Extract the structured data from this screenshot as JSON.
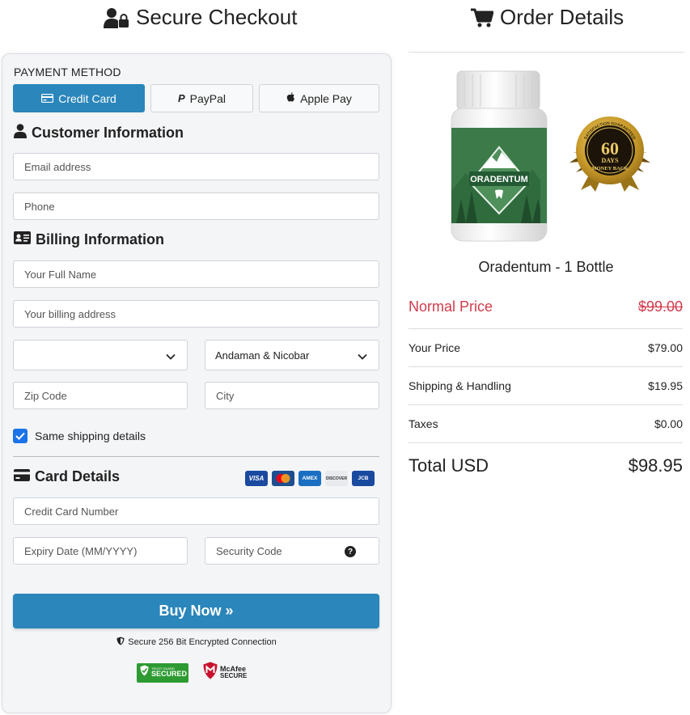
{
  "checkout": {
    "title": "Secure Checkout",
    "payment_method_label": "PAYMENT METHOD",
    "tabs": [
      {
        "label": "Credit Card",
        "active": true
      },
      {
        "label": "PayPal",
        "active": false
      },
      {
        "label": "Apple Pay",
        "active": false
      }
    ],
    "customer_title": "Customer Information",
    "email_placeholder": "Email address",
    "phone_placeholder": "Phone",
    "billing_title": "Billing Information",
    "fullname_placeholder": "Your Full Name",
    "address_placeholder": "Your billing address",
    "country_value": "",
    "state_value": "Andaman & Nicobar",
    "zip_placeholder": "Zip Code",
    "city_placeholder": "City",
    "same_shipping_label": "Same shipping details",
    "same_shipping_checked": true,
    "card_title": "Card Details",
    "card_brands": [
      "VISA",
      "mastercard",
      "AMEX",
      "DISCOVER",
      "JCB"
    ],
    "card_number_placeholder": "Credit Card Number",
    "expiry_placeholder": "Expiry Date (MM/YYYY)",
    "cvv_placeholder": "Security Code",
    "buy_label": "Buy Now »",
    "secure_text": "Secure 256 Bit Encrypted Connection",
    "trust_badge": {
      "line1": "TRUST GUARD",
      "line2": "SECURED"
    },
    "mcafee_badge": {
      "line1": "McAfee",
      "line2": "SECURE"
    }
  },
  "order": {
    "title": "Order Details",
    "product_name": "Oradentum - 1 Bottle",
    "bottle_label": "ORADENTUM",
    "seal": {
      "top": "60",
      "middle": "DAYS",
      "bottom": "MONEY BACK",
      "ring": "SATISFACTION GUARANTEED"
    },
    "normal_price_label": "Normal Price",
    "normal_price": "$99.00",
    "your_price_label": "Your Price",
    "your_price": "$79.00",
    "shipping_label": "Shipping & Handling",
    "shipping": "$19.95",
    "taxes_label": "Taxes",
    "taxes": "$0.00",
    "total_label": "Total USD",
    "total": "$98.95"
  },
  "colors": {
    "accent": "#2a86bb",
    "strike_red": "#d33b4b",
    "checkbox": "#1a73e8"
  }
}
